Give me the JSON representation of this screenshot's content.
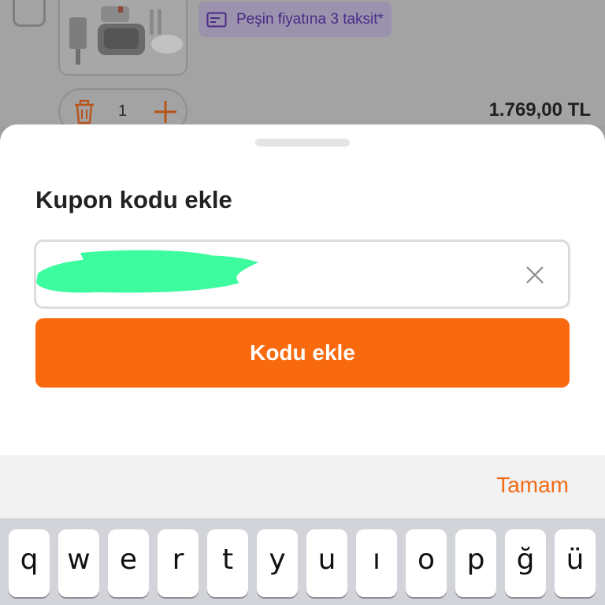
{
  "background": {
    "installment_badge": "Peşin fiyatına 3 taksit*",
    "quantity": "1",
    "price": "1.769,00 TL"
  },
  "sheet": {
    "title": "Kupon kodu ekle",
    "coupon_input": {
      "value": "",
      "placeholder": ""
    },
    "submit_label": "Kodu ekle"
  },
  "accessory": {
    "done_label": "Tamam"
  },
  "keyboard": {
    "row1": [
      "q",
      "w",
      "e",
      "r",
      "t",
      "y",
      "u",
      "ı",
      "o",
      "p",
      "ğ",
      "ü"
    ]
  },
  "colors": {
    "accent": "#F96A0F",
    "badge_text": "#4A2A86"
  }
}
